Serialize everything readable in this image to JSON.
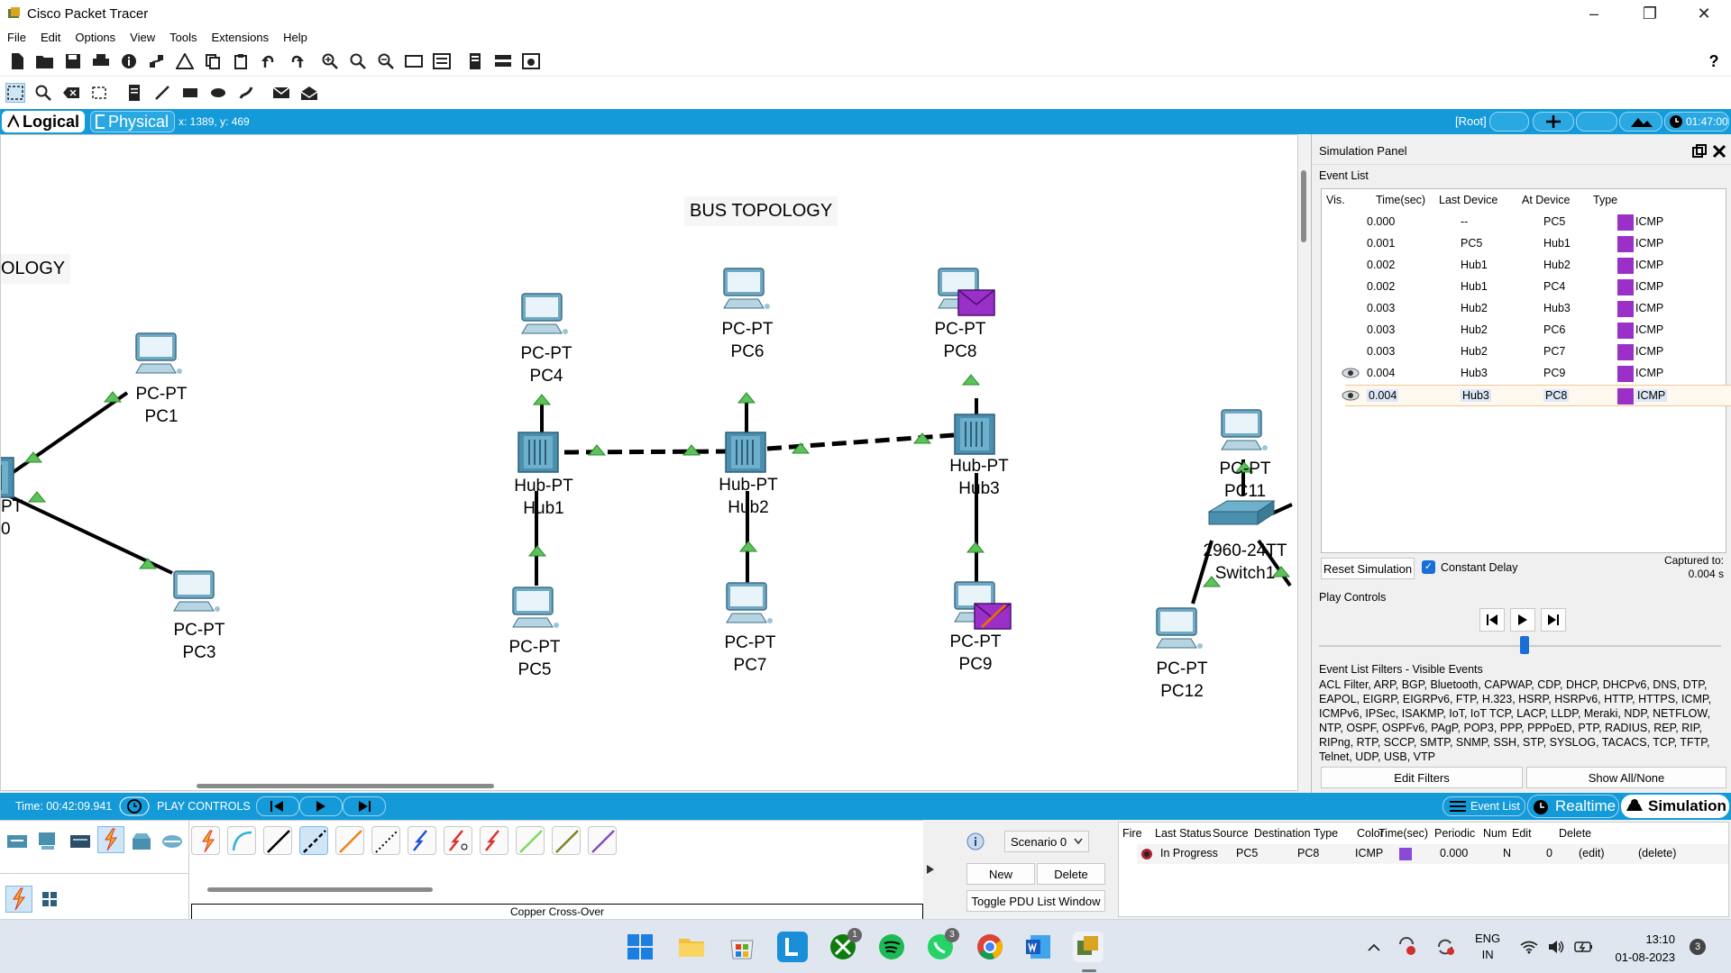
{
  "window": {
    "title": "Cisco Packet Tracer"
  },
  "menu": [
    "File",
    "Edit",
    "Options",
    "View",
    "Tools",
    "Extensions",
    "Help"
  ],
  "nav": {
    "logical": "Logical",
    "physical": "Physical",
    "coords": "x: 1389, y: 469",
    "root": "[Root]",
    "clock": "01:47:00"
  },
  "canvas": {
    "title1": "BUS TOPOLOGY",
    "title2": "OLOGY",
    "partial_a": "PT",
    "partial_b": "0",
    "devices": [
      {
        "type": "PC-PT",
        "name": "PC1"
      },
      {
        "type": "PC-PT",
        "name": "PC3"
      },
      {
        "type": "PC-PT",
        "name": "PC4"
      },
      {
        "type": "PC-PT",
        "name": "PC6"
      },
      {
        "type": "PC-PT",
        "name": "PC8"
      },
      {
        "type": "Hub-PT",
        "name": "Hub1"
      },
      {
        "type": "Hub-PT",
        "name": "Hub2"
      },
      {
        "type": "Hub-PT",
        "name": "Hub3"
      },
      {
        "type": "PC-PT",
        "name": "PC5"
      },
      {
        "type": "PC-PT",
        "name": "PC7"
      },
      {
        "type": "PC-PT",
        "name": "PC9"
      },
      {
        "type": "PC-PT",
        "name": "PC11"
      },
      {
        "type": "2960-24TT",
        "name": "Switch1"
      },
      {
        "type": "PC-PT",
        "name": "PC12"
      }
    ]
  },
  "sim": {
    "panel_title": "Simulation Panel",
    "event_list_label": "Event List",
    "headers": [
      "Vis.",
      "Time(sec)",
      "Last Device",
      "At Device",
      "Type"
    ],
    "events": [
      {
        "time": "0.000",
        "last": "--",
        "at": "PC5",
        "type": "ICMP",
        "eye": false
      },
      {
        "time": "0.001",
        "last": "PC5",
        "at": "Hub1",
        "type": "ICMP",
        "eye": false
      },
      {
        "time": "0.002",
        "last": "Hub1",
        "at": "Hub2",
        "type": "ICMP",
        "eye": false
      },
      {
        "time": "0.002",
        "last": "Hub1",
        "at": "PC4",
        "type": "ICMP",
        "eye": false
      },
      {
        "time": "0.003",
        "last": "Hub2",
        "at": "Hub3",
        "type": "ICMP",
        "eye": false
      },
      {
        "time": "0.003",
        "last": "Hub2",
        "at": "PC6",
        "type": "ICMP",
        "eye": false
      },
      {
        "time": "0.003",
        "last": "Hub2",
        "at": "PC7",
        "type": "ICMP",
        "eye": false
      },
      {
        "time": "0.004",
        "last": "Hub3",
        "at": "PC9",
        "type": "ICMP",
        "eye": true
      },
      {
        "time": "0.004",
        "last": "Hub3",
        "at": "PC8",
        "type": "ICMP",
        "eye": true
      }
    ],
    "reset": "Reset Simulation",
    "constant_delay": "Constant Delay",
    "captured_label": "Captured to:",
    "captured_value": "0.004 s",
    "play_controls": "Play Controls",
    "filters_title": "Event List Filters - Visible Events",
    "filters_text": "ACL Filter, ARP, BGP, Bluetooth, CAPWAP, CDP, DHCP, DHCPv6, DNS, DTP, EAPOL, EIGRP, EIGRPv6, FTP, H.323, HSRP, HSRPv6, HTTP, HTTPS, ICMP, ICMPv6, IPSec, ISAKMP, IoT, IoT TCP, LACP, LLDP, Meraki, NDP, NETFLOW, NTP, OSPF, OSPFv6, PAgP, POP3, PPP, PPPoED, PTP, RADIUS, REP, RIP, RIPng, RTP, SCCP, SMTP, SNMP, SSH, STP, SYSLOG, TACACS, TCP, TFTP, Telnet, UDP, USB, VTP",
    "edit_filters": "Edit Filters",
    "show_all": "Show All/None"
  },
  "bottom": {
    "time": "Time: 00:42:09.941",
    "play": "PLAY CONTROLS",
    "event_list": "Event List",
    "realtime": "Realtime",
    "simulation": "Simulation"
  },
  "devices_panel": {
    "selected_cable": "Copper Cross-Over"
  },
  "scenario": {
    "name": "Scenario 0",
    "new": "New",
    "delete": "Delete",
    "toggle": "Toggle PDU List Window"
  },
  "pdu": {
    "headers": [
      "Fire",
      "Last Status",
      "Source",
      "Destination",
      "Type",
      "Color",
      "Time(sec)",
      "Periodic",
      "Num",
      "Edit",
      "Delete"
    ],
    "row": {
      "status": "In Progress",
      "source": "PC5",
      "dest": "PC8",
      "type": "ICMP",
      "time": "0.000",
      "periodic": "N",
      "num": "0",
      "edit": "(edit)",
      "delete": "(delete)"
    }
  },
  "taskbar": {
    "lang1": "ENG",
    "lang2": "IN",
    "time": "13:10",
    "date": "01-08-2023",
    "notif": "3",
    "badge_xbox": "1",
    "badge_whatsapp": "3"
  }
}
